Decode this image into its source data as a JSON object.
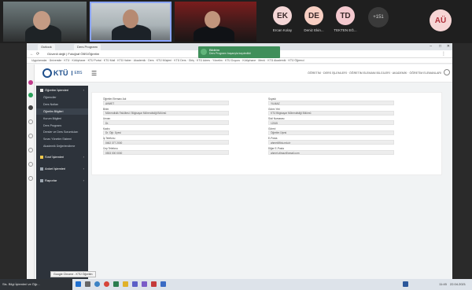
{
  "meeting": {
    "participants": [
      {
        "initials": "EK",
        "name": "Ercan Kolay",
        "color": "#f5d7d7"
      },
      {
        "initials": "DE",
        "name": "Deniz Ekin...",
        "color": "#f8cfc3"
      },
      {
        "initials": "TD",
        "name": "TEKTEN EĞ...",
        "color": "#f4c9cf"
      }
    ],
    "more_count": "+151",
    "self_initials": "AÜ"
  },
  "browser": {
    "tabs": [
      "Outlook",
      "Ders Programı"
    ],
    "url": "Güvenli değil | Fotoğraf ÖBS/Öğretim",
    "bookmarks": "Uygulamalar · Üniversite · KTÜ · Kütüphane · KTÜ Portal · KTÜ Mail · KTÜ Haber · Akademik · Ders · KTÜ Müşteri · KTÜ Ders · Giriş · KTÜ Adres · Yönetim · KTÜ Duyuru · Kütüphane · Menü · KTÜ Akademik · KTÜ Öğrenci",
    "notification": {
      "title": "Bildirim",
      "text": "Ders Programı başarıyla kaydedildi"
    }
  },
  "app": {
    "logo_text": "KTÜ",
    "logo_sub": "EBS",
    "menu_icon": "☰",
    "breadcrumb": "ÖĞRETİM · DERS İŞLEMLERİ · ÖĞRETİM ELEMANI BİLGİLERİ · AKADEMİK · ÖĞRETİM ELEMANLARI",
    "sidebar": [
      {
        "type": "group",
        "label": "Öğretim İşlemleri",
        "icon_color": "#e0e0e0"
      },
      {
        "type": "item",
        "label": "Öğrenciler"
      },
      {
        "type": "item",
        "label": "Ders Notları"
      },
      {
        "type": "item",
        "label": "Öğretim Bilgileri",
        "active": true
      },
      {
        "type": "item",
        "label": "Kurum Bilgileri"
      },
      {
        "type": "item",
        "label": "Ders Programı"
      },
      {
        "type": "item",
        "label": "Dersler ve Ders Sorumluları"
      },
      {
        "type": "item",
        "label": "Sınav Yönetim Sistemi"
      },
      {
        "type": "item",
        "label": "Akademik Değerlendirme"
      },
      {
        "type": "group",
        "label": "Sınıf İşlemleri",
        "icon_color": "#f2c94c"
      },
      {
        "type": "group",
        "label": "Anket İşlemleri",
        "icon_color": "#9aa4ae"
      },
      {
        "type": "group",
        "label": "Raporlar",
        "icon_color": "#9aa4ae"
      }
    ],
    "form_left": [
      {
        "label": "Öğretim Elemanı Adı",
        "value": "AHMET"
      },
      {
        "label": "Birim",
        "value": "Mühendislik Fakültesi / Bilgisayar Mühendisliği Bölümü"
      },
      {
        "label": "Unvan",
        "value": "Dr."
      },
      {
        "label": "Kadro",
        "value": "Dr. Öğr. Üyesi"
      },
      {
        "label": "İş Telefonu",
        "value": "0462 377 2000"
      },
      {
        "label": "Cep Telefonu",
        "value": "0533 000 0000"
      }
    ],
    "form_right": [
      {
        "label": "Soyadı",
        "value": "YILMAZ"
      },
      {
        "label": "Görev Yeri",
        "value": "KTÜ Bilgisayar Mühendisliği Bölümü"
      },
      {
        "label": "Sicil Numarası",
        "value": "12345"
      },
      {
        "label": "Görevi",
        "value": "Öğretim Üyesi"
      },
      {
        "label": "E-Posta",
        "value": "ahmet@ktu.edu.tr"
      },
      {
        "label": "Diğer E-Posta",
        "value": "ahmet.yilmaz@gmail.com"
      }
    ]
  },
  "taskbar": {
    "left_label": "Sis. Bilgi İşlemleri ve Öğr...",
    "tooltip": "Google Chrome - KTÜ Öğretim",
    "clock": "11:45",
    "date": "22.04.2021"
  }
}
